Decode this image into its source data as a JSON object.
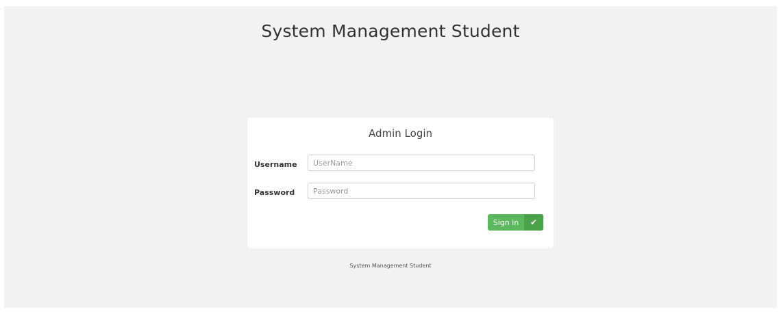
{
  "header": {
    "title": "System Management Student"
  },
  "login": {
    "title": "Admin Login",
    "username_label": "Username",
    "username_placeholder": "UserName",
    "username_value": "",
    "password_label": "Password",
    "password_placeholder": "Password",
    "password_value": "",
    "signin_label": "Sign in",
    "signin_icon": "check-icon"
  },
  "footer": {
    "text": "System Management Student"
  },
  "colors": {
    "page_bg": "#f2f2f2",
    "card_bg": "#ffffff",
    "button_bg": "#5cb85c",
    "button_icon_bg": "#4aa24a"
  }
}
